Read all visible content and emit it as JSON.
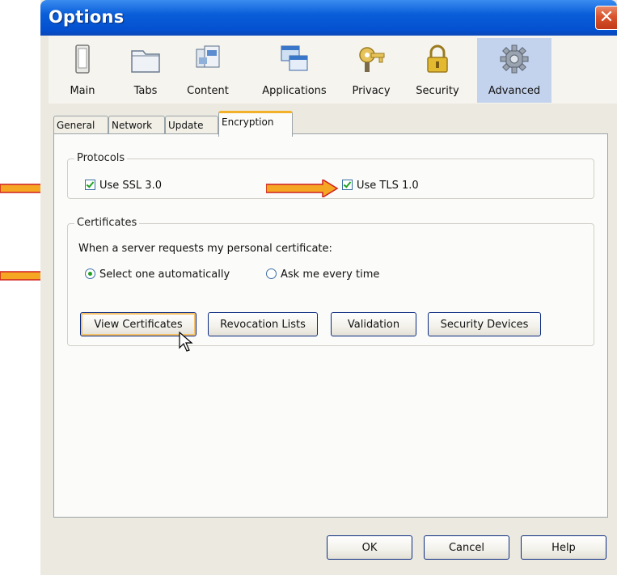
{
  "window": {
    "title": "Options",
    "close_glyph": "✕"
  },
  "toolbar": {
    "items": [
      {
        "label": "Main",
        "icon": "main-icon"
      },
      {
        "label": "Tabs",
        "icon": "tabs-icon"
      },
      {
        "label": "Content",
        "icon": "content-icon"
      },
      {
        "label": "Applications",
        "icon": "applications-icon"
      },
      {
        "label": "Privacy",
        "icon": "privacy-icon"
      },
      {
        "label": "Security",
        "icon": "security-icon"
      },
      {
        "label": "Advanced",
        "icon": "advanced-gear-icon",
        "selected": true
      }
    ]
  },
  "tabs": [
    {
      "label": "General"
    },
    {
      "label": "Network"
    },
    {
      "label": "Update"
    },
    {
      "label": "Encryption",
      "selected": true
    }
  ],
  "protocols": {
    "title": "Protocols",
    "ssl": {
      "label": "Use SSL 3.0",
      "checked": true
    },
    "tls": {
      "label": "Use TLS 1.0",
      "checked": true
    }
  },
  "certificates": {
    "title": "Certificates",
    "prompt": "When a server requests my personal certificate:",
    "auto": {
      "label": "Select one automatically",
      "selected": true
    },
    "ask": {
      "label": "Ask me every time",
      "selected": false
    },
    "buttons": {
      "view": "View Certificates",
      "revocation": "Revocation Lists",
      "validation": "Validation",
      "devices": "Security Devices"
    }
  },
  "footer": {
    "ok": "OK",
    "cancel": "Cancel",
    "help": "Help"
  },
  "colors": {
    "title_bar": "#0a5ed8",
    "selected_tab_accent": "#f2b12a",
    "annotation_arrow": "#f5a623",
    "check_mark": "#21a121"
  }
}
